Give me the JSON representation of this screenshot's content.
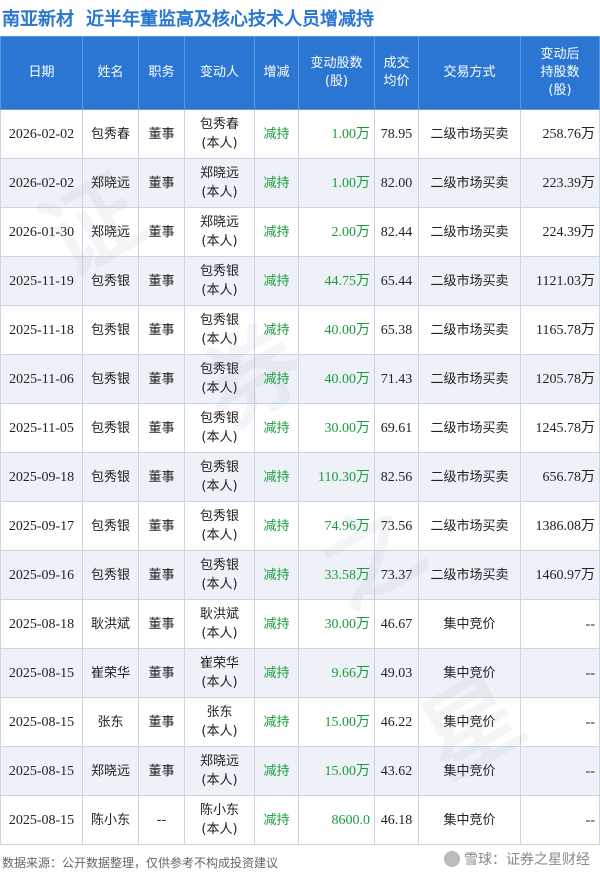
{
  "header": {
    "company": "南亚新材",
    "subtitle": "近半年董监高及核心技术人员增减持"
  },
  "table": {
    "columns": [
      "日期",
      "姓名",
      "职务",
      "变动人",
      "增减",
      "变动股数\n(股)",
      "成交\n均价",
      "交易方式",
      "变动后\n持股数\n(股)"
    ],
    "rows": [
      [
        "2026-02-02",
        "包秀春",
        "董事",
        "包秀春\n(本人)",
        "减持",
        "1.00万",
        "78.95",
        "二级市场买卖",
        "258.76万"
      ],
      [
        "2026-02-02",
        "郑晓远",
        "董事",
        "郑晓远\n(本人)",
        "减持",
        "1.00万",
        "82.00",
        "二级市场买卖",
        "223.39万"
      ],
      [
        "2026-01-30",
        "郑晓远",
        "董事",
        "郑晓远\n(本人)",
        "减持",
        "2.00万",
        "82.44",
        "二级市场买卖",
        "224.39万"
      ],
      [
        "2025-11-19",
        "包秀银",
        "董事",
        "包秀银\n(本人)",
        "减持",
        "44.75万",
        "65.44",
        "二级市场买卖",
        "1121.03万"
      ],
      [
        "2025-11-18",
        "包秀银",
        "董事",
        "包秀银\n(本人)",
        "减持",
        "40.00万",
        "65.38",
        "二级市场买卖",
        "1165.78万"
      ],
      [
        "2025-11-06",
        "包秀银",
        "董事",
        "包秀银\n(本人)",
        "减持",
        "40.00万",
        "71.43",
        "二级市场买卖",
        "1205.78万"
      ],
      [
        "2025-11-05",
        "包秀银",
        "董事",
        "包秀银\n(本人)",
        "减持",
        "30.00万",
        "69.61",
        "二级市场买卖",
        "1245.78万"
      ],
      [
        "2025-09-18",
        "包秀银",
        "董事",
        "包秀银\n(本人)",
        "减持",
        "110.30万",
        "82.56",
        "二级市场买卖",
        "656.78万"
      ],
      [
        "2025-09-17",
        "包秀银",
        "董事",
        "包秀银\n(本人)",
        "减持",
        "74.96万",
        "73.56",
        "二级市场买卖",
        "1386.08万"
      ],
      [
        "2025-09-16",
        "包秀银",
        "董事",
        "包秀银\n(本人)",
        "减持",
        "33.58万",
        "73.37",
        "二级市场买卖",
        "1460.97万"
      ],
      [
        "2025-08-18",
        "耿洪斌",
        "董事",
        "耿洪斌\n(本人)",
        "减持",
        "30.00万",
        "46.67",
        "集中竞价",
        "--"
      ],
      [
        "2025-08-15",
        "崔荣华",
        "董事",
        "崔荣华\n(本人)",
        "减持",
        "9.66万",
        "49.03",
        "集中竞价",
        "--"
      ],
      [
        "2025-08-15",
        "张东",
        "董事",
        "张东\n(本人)",
        "减持",
        "15.00万",
        "46.22",
        "集中竞价",
        "--"
      ],
      [
        "2025-08-15",
        "郑晓远",
        "董事",
        "郑晓远\n(本人)",
        "减持",
        "15.00万",
        "43.62",
        "集中竞价",
        "--"
      ],
      [
        "2025-08-15",
        "陈小东",
        "--",
        "陈小东\n(本人)",
        "减持",
        "8600.0",
        "46.18",
        "集中竞价",
        "--"
      ]
    ]
  },
  "footer": {
    "source": "数据来源：公开数据整理，仅供参考不构成投资建议",
    "brand": "雪球：证券之星财经"
  },
  "watermark": {
    "text": [
      "证",
      "券",
      "之",
      "星"
    ]
  },
  "colors": {
    "header_bg": "#2a76d2",
    "title": "#2a76d2",
    "decrease": "#1a9c3c",
    "row_alt": "#eef2f8"
  }
}
